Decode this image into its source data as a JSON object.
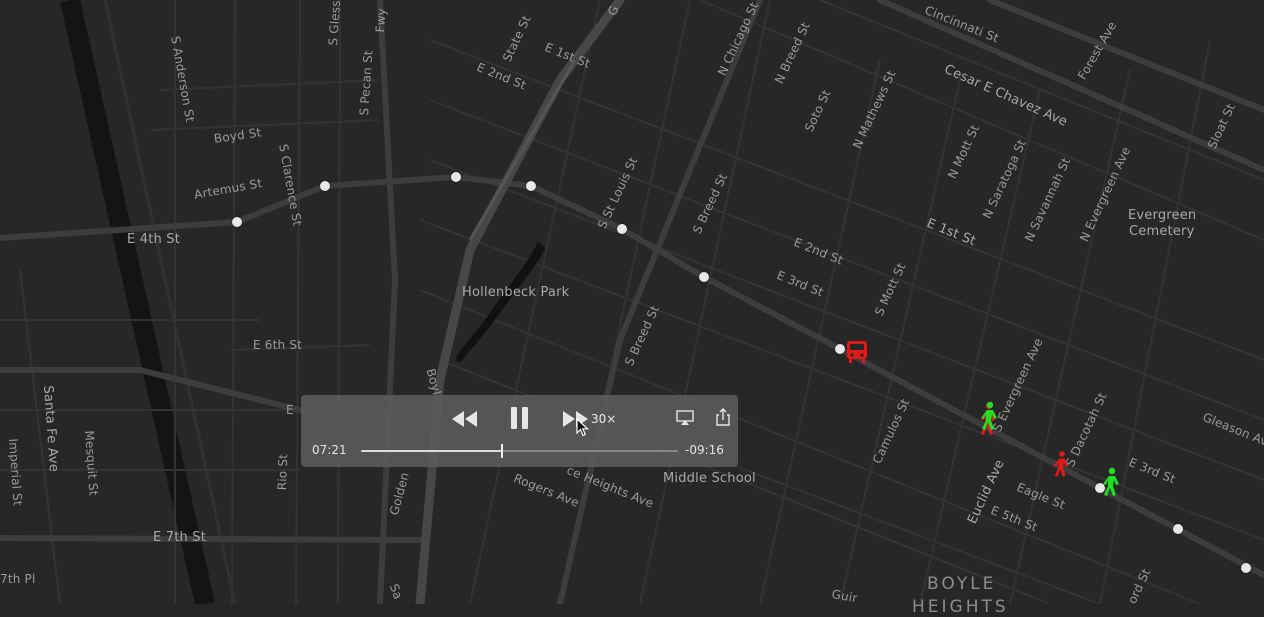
{
  "map": {
    "streets": [
      {
        "id": "s-anderson",
        "text": "S Anderson St"
      },
      {
        "id": "s-gless",
        "text": "S Gless St"
      },
      {
        "id": "s-pecan",
        "text": "S Pecan St"
      },
      {
        "id": "fwy",
        "text": "Fwy"
      },
      {
        "id": "boyd",
        "text": "Boyd St"
      },
      {
        "id": "artemus",
        "text": "Artemus St"
      },
      {
        "id": "s-clarence",
        "text": "S Clarence St"
      },
      {
        "id": "e4th",
        "text": "E 4th St"
      },
      {
        "id": "e6th",
        "text": "E 6th St"
      },
      {
        "id": "e6th-partial",
        "text": "E"
      },
      {
        "id": "santa-fe",
        "text": "Santa Fe Ave"
      },
      {
        "id": "mesquit",
        "text": "Mesquit St"
      },
      {
        "id": "imperial",
        "text": "Imperial St"
      },
      {
        "id": "rio",
        "text": "Rio St"
      },
      {
        "id": "e7th",
        "text": "E 7th St"
      },
      {
        "id": "7thpl",
        "text": "7th Pl"
      },
      {
        "id": "e2nd-top",
        "text": "E 2nd St"
      },
      {
        "id": "state",
        "text": "State St"
      },
      {
        "id": "e1st-top",
        "text": "E 1st St"
      },
      {
        "id": "g",
        "text": "G"
      },
      {
        "id": "n-chicago",
        "text": "N Chicago St"
      },
      {
        "id": "n-breed",
        "text": "N Breed St"
      },
      {
        "id": "soto",
        "text": "Soto St"
      },
      {
        "id": "n-mathews",
        "text": "N Mathews St"
      },
      {
        "id": "cincinnati",
        "text": "Cincinnati St"
      },
      {
        "id": "cesar",
        "text": "Cesar E Chavez Ave"
      },
      {
        "id": "forest",
        "text": "Forest Ave"
      },
      {
        "id": "sloat",
        "text": "Sloat St"
      },
      {
        "id": "n-mott",
        "text": "N Mott St"
      },
      {
        "id": "n-saratoga",
        "text": "N Saratoga St"
      },
      {
        "id": "n-savannah",
        "text": "N Savannah St"
      },
      {
        "id": "n-evergreen",
        "text": "N Evergreen Ave"
      },
      {
        "id": "s-st-louis",
        "text": "S St Louis St"
      },
      {
        "id": "s-breed-top",
        "text": "S Breed St"
      },
      {
        "id": "e2nd-mid",
        "text": "E 2nd St"
      },
      {
        "id": "e3rd-mid",
        "text": "E 3rd St"
      },
      {
        "id": "s-mott",
        "text": "S Mott St"
      },
      {
        "id": "e1st-right",
        "text": "E 1st St"
      },
      {
        "id": "s-breed-low",
        "text": "S Breed St"
      },
      {
        "id": "camulos",
        "text": "Camulos St"
      },
      {
        "id": "s-evergreen",
        "text": "S Evergreen Ave"
      },
      {
        "id": "s-dacotah",
        "text": "S Dacotah St"
      },
      {
        "id": "gleason",
        "text": "Gleason Av"
      },
      {
        "id": "e3rd-right",
        "text": "E 3rd St"
      },
      {
        "id": "euclid",
        "text": "Euclid Ave"
      },
      {
        "id": "eagle",
        "text": "Eagle St"
      },
      {
        "id": "e5th",
        "text": "E 5th St"
      },
      {
        "id": "rogers",
        "text": "Rogers Ave"
      },
      {
        "id": "heights",
        "text": "ce Heights Ave"
      },
      {
        "id": "golden",
        "text": "Golden"
      },
      {
        "id": "boyle-st",
        "text": "Boyl"
      },
      {
        "id": "guir",
        "text": "Guir"
      },
      {
        "id": "ord",
        "text": "ord St"
      },
      {
        "id": "sa",
        "text": "Sa"
      }
    ],
    "places": {
      "hollenbeck": "Hollenbeck Park",
      "evergreen_1": "Evergreen",
      "evergreen_2": "Cemetery",
      "middle_school": "Middle School",
      "boyle_heights_1": "BOYLE",
      "boyle_heights_2": "HEIGHTS"
    }
  },
  "colors": {
    "delayed": "#e01919",
    "on_time": "#22dd22",
    "stop": "#e8e8e8"
  },
  "vehicles": [
    {
      "name": "bus-icon",
      "status": "delayed"
    },
    {
      "name": "pedestrian-icon",
      "status": "on_time"
    },
    {
      "name": "pedestrian-icon",
      "status": "delayed"
    },
    {
      "name": "pedestrian-icon",
      "status": "on_time"
    }
  ],
  "player": {
    "speed": "30×",
    "elapsed": "07:21",
    "remaining": "-09:16",
    "progress": 0.445,
    "icons": {
      "rewind": "rewind-icon",
      "pause": "pause-icon",
      "forward": "fast-forward-icon",
      "airplay": "airplay-icon",
      "share": "share-icon"
    }
  }
}
